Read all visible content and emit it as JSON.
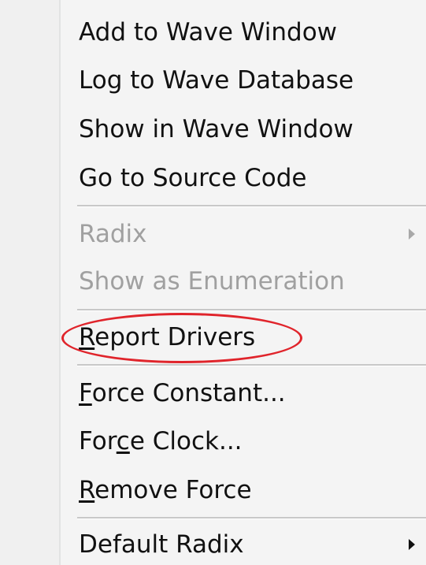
{
  "menu": {
    "items": [
      {
        "label": "Add to Wave Window",
        "enabled": true
      },
      {
        "label": "Log to Wave Database",
        "enabled": true
      },
      {
        "label": "Show in Wave Window",
        "enabled": true
      },
      {
        "label": "Go to Source Code",
        "enabled": true
      },
      {
        "label": "Radix",
        "enabled": false,
        "submenu": true
      },
      {
        "label": "Show as Enumeration",
        "enabled": false
      },
      {
        "label": "Report Drivers",
        "enabled": true,
        "mnemonic": "R",
        "rest": "eport Drivers",
        "highlighted": true
      },
      {
        "label": "Force Constant...",
        "enabled": true,
        "mnemonic": "F",
        "rest": "orce Constant..."
      },
      {
        "label": "Force Clock...",
        "enabled": true,
        "pre": "For",
        "mnemonic": "c",
        "rest": "e Clock..."
      },
      {
        "label": "Remove Force",
        "enabled": true,
        "mnemonic": "R",
        "rest": "emove Force"
      },
      {
        "label": "Default Radix",
        "enabled": true,
        "submenu": true
      }
    ]
  },
  "colors": {
    "menu_background": "#f4f4f4",
    "disabled_text": "#a0a0a0",
    "highlight_annotation": "#e0242b"
  },
  "icons": {
    "submenu_arrow": "chevron-right-icon"
  }
}
